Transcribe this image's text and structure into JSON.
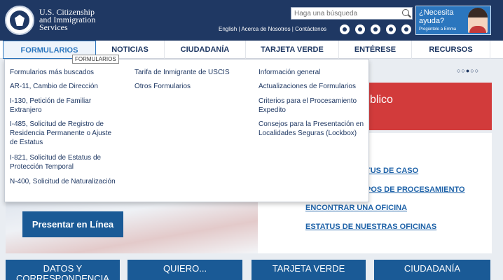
{
  "header": {
    "logo_line1": "U.S. Citizenship",
    "logo_line2": "and Immigration",
    "logo_line3": "Services",
    "search_placeholder": "Haga una búsqueda",
    "utility_links": "English | Acerca de Nosotros | Contáctenos",
    "emma_question_line1": "¿Necesita",
    "emma_question_line2": "ayuda?",
    "emma_sub": "Pregúntele a Emma"
  },
  "nav": {
    "items": [
      "FORMULARIOS",
      "NOTICIAS",
      "CIUDADANÍA",
      "TARJETA VERDE",
      "ENTÉRESE",
      "RECURSOS"
    ],
    "tooltip": "FORMULARIOS"
  },
  "dropdown": {
    "col1": [
      "Formularios más buscados",
      "AR-11, Cambio de Dirección",
      "I-130, Petición de Familiar Extranjero",
      "I-485, Solicitud de Registro de Residencia Permanente o Ajuste de Estatus",
      "I-821, Solicitud de Estatus de Protección Temporal",
      "N-400, Solicitud de Naturalización"
    ],
    "col2": [
      "Tarifa de Inmigrante de USCIS",
      "Otros Formularios"
    ],
    "col3": [
      "Información general",
      "Actualizaciones de Formularios",
      "Criterios para el Procesamiento Expedito",
      "Consejos para la Presentación en Localidades Seguras (Lockbox)"
    ]
  },
  "main": {
    "carousel_dots": "○○●○○",
    "banner_text": "blico",
    "links": [
      "TUS DE CASO",
      "POS DE PROCESAMIENTO",
      "ENCONTRAR UNA OFICINA",
      "ESTATUS DE NUESTRAS OFICINAS"
    ],
    "presentar_button": "Presentar en Línea"
  },
  "tiles": [
    "DATOS Y CORRESPONDENCIA",
    "QUIERO...",
    "TARJETA VERDE",
    "CIUDADANÍA"
  ],
  "colors": {
    "header_bg": "#1f3863",
    "accent": "#2b76be",
    "banner_red": "#d23b3b",
    "tile_blue": "#1a5a96"
  }
}
